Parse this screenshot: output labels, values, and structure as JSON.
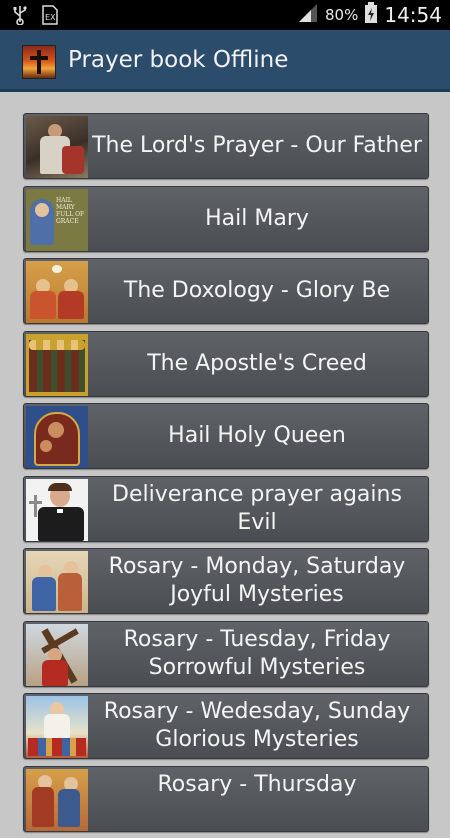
{
  "status": {
    "battery": "80%",
    "time": "14:54"
  },
  "app": {
    "title": "Prayer book Offline"
  },
  "items": [
    {
      "line1": "The Lord's Prayer - Our Father",
      "line2": ""
    },
    {
      "line1": "Hail Mary",
      "line2": "",
      "thumb_text": "HAIL MARY FULL OF GRACE"
    },
    {
      "line1": "The Doxology - Glory Be",
      "line2": ""
    },
    {
      "line1": "The Apostle's Creed",
      "line2": ""
    },
    {
      "line1": "Hail Holy Queen",
      "line2": ""
    },
    {
      "line1": "Deliverance prayer agains Evil",
      "line2": ""
    },
    {
      "line1": "Rosary - Monday, Saturday",
      "line2": "Joyful Mysteries"
    },
    {
      "line1": "Rosary - Tuesday, Friday",
      "line2": "Sorrowful Mysteries"
    },
    {
      "line1": "Rosary - Wedesday, Sunday",
      "line2": "Glorious Mysteries"
    },
    {
      "line1": "Rosary - Thursday",
      "line2": ""
    }
  ]
}
